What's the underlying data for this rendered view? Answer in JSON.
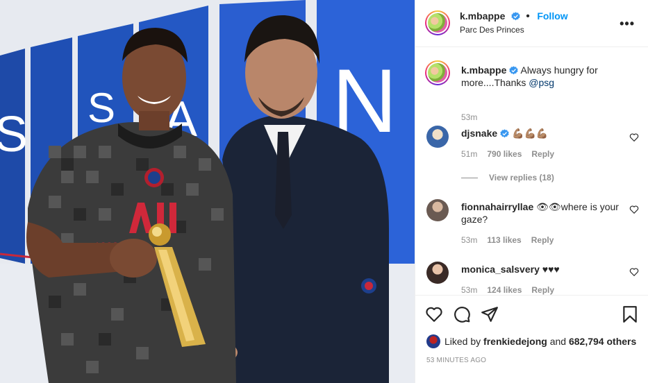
{
  "header": {
    "username": "k.mbappe",
    "follow_label": "Follow",
    "location": "Parc Des Princes",
    "more_label": "•••"
  },
  "caption": {
    "username": "k.mbappe",
    "text": "Always hungry for more....Thanks ",
    "mention": "@psg",
    "age": "53m"
  },
  "comments": [
    {
      "username": "djsnake",
      "text": "💪🏽💪🏽💪🏽",
      "age": "51m",
      "likes": "790 likes",
      "reply": "Reply",
      "view_replies": "View replies (18)"
    },
    {
      "username": "fionnahairryllae",
      "text": "👁👁where is your gaze?",
      "age": "53m",
      "likes": "113 likes",
      "reply": "Reply"
    },
    {
      "username": "monica_salsvery",
      "text": "♥♥♥",
      "age": "53m",
      "likes": "124 likes",
      "reply": "Reply"
    }
  ],
  "footer": {
    "liked_prefix": "Liked by ",
    "liked_user": "frenkiedejong",
    "liked_mid": " and ",
    "liked_count": "682,794 others",
    "timestamp": "53 MINUTES AGO"
  },
  "colors": {
    "accent": "#0095f6",
    "verified": "#3897f0",
    "muted": "#8e8e8e",
    "psg_navy": "#1d3f8c"
  },
  "icons": [
    "verified-icon",
    "more-icon",
    "heart-icon",
    "comment-icon",
    "share-icon",
    "bookmark-icon"
  ]
}
